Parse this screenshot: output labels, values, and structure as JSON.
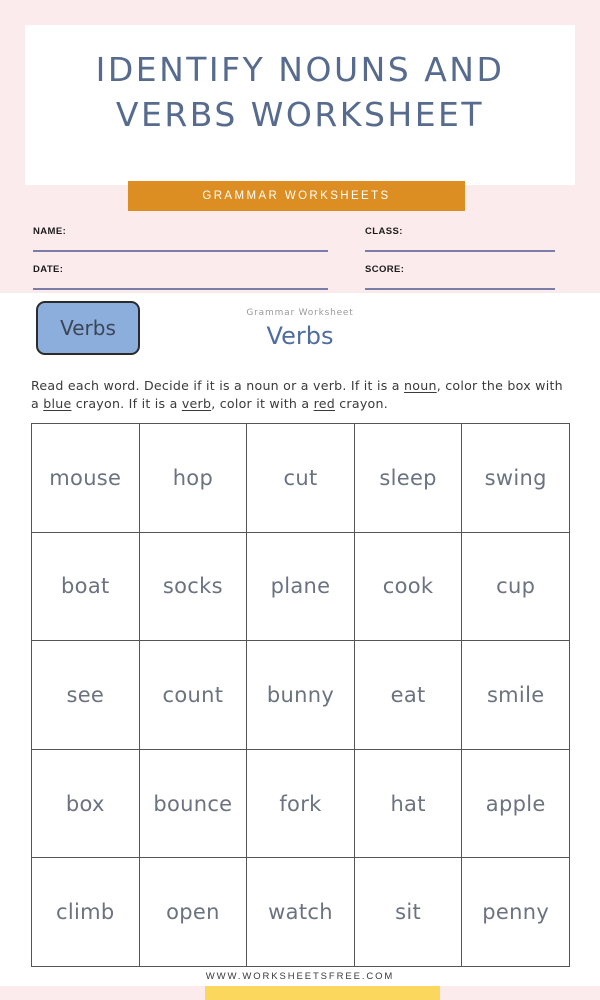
{
  "page": {
    "background_color": "#ffffff",
    "band_color": "#fcebec"
  },
  "header": {
    "title": "IDENTIFY NOUNS AND\nVERBS WORKSHEET",
    "title_color": "#566b8e",
    "category_badge": "GRAMMAR WORKSHEETS",
    "badge_color": "#dd8e22"
  },
  "fields": {
    "name": {
      "label": "NAME:",
      "value": "",
      "placeholder": ""
    },
    "class": {
      "label": "CLASS:",
      "value": "",
      "placeholder": ""
    },
    "date": {
      "label": "DATE:",
      "value": "",
      "placeholder": ""
    },
    "score": {
      "label": "SCORE:",
      "value": "",
      "placeholder": ""
    },
    "line_color": "#7b7da8"
  },
  "topic": {
    "chip_label": "Verbs",
    "chip_color": "#8caedc",
    "kicker": "Grammar Worksheet",
    "title": "Verbs",
    "title_color": "#4f6d9e"
  },
  "instructions": {
    "part1": "Read each word.  Decide if it is a noun or a verb.  If it is a ",
    "em1": "noun",
    "part2": ", color the box with a ",
    "em2": "blue",
    "part3": " crayon.  If it is a ",
    "em3": "verb",
    "part4": ", color it with a ",
    "em4": "red",
    "part5": " crayon."
  },
  "grid": {
    "rows": 5,
    "columns": 5,
    "border_color": "#555555",
    "word_color": "#6b7280",
    "words": [
      [
        "mouse",
        "hop",
        "cut",
        "sleep",
        "swing"
      ],
      [
        "boat",
        "socks",
        "plane",
        "cook",
        "cup"
      ],
      [
        "see",
        "count",
        "bunny",
        "eat",
        "smile"
      ],
      [
        "box",
        "bounce",
        "fork",
        "hat",
        "apple"
      ],
      [
        "climb",
        "open",
        "watch",
        "sit",
        "penny"
      ]
    ],
    "flat_words": [
      "mouse",
      "hop",
      "cut",
      "sleep",
      "swing",
      "boat",
      "socks",
      "plane",
      "cook",
      "cup",
      "see",
      "count",
      "bunny",
      "eat",
      "smile",
      "box",
      "bounce",
      "fork",
      "hat",
      "apple",
      "climb",
      "open",
      "watch",
      "sit",
      "penny"
    ]
  },
  "footer": {
    "url": "WWW.WORKSHEETSFREE.COM",
    "accent_color": "#fbd85d"
  }
}
